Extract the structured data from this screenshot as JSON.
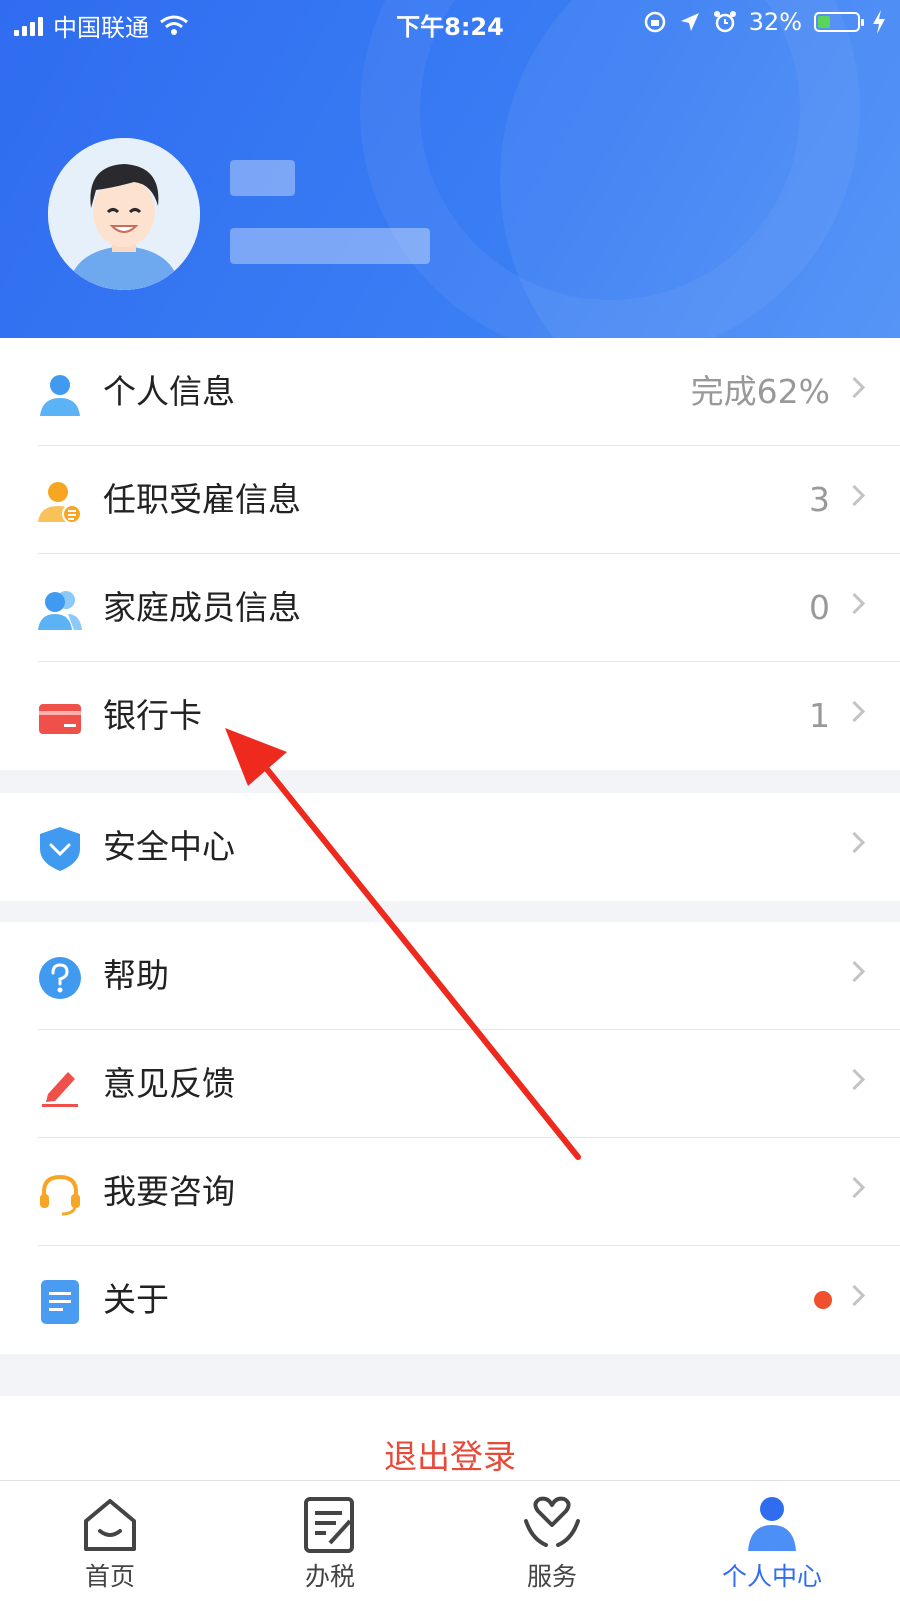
{
  "status_bar": {
    "carrier": "中国联通",
    "time": "下午8:24",
    "battery": "32%",
    "battery_level": 0.32
  },
  "colors": {
    "accent": "#2f6cf0",
    "logout": "#e84a3a",
    "badge_dot": "#f0502d"
  },
  "menu_groups": [
    [
      {
        "label": "个人信息",
        "value": "完成62%",
        "icon": "person-icon"
      },
      {
        "label": "任职受雇信息",
        "value": "3",
        "icon": "employment-icon"
      },
      {
        "label": "家庭成员信息",
        "value": "0",
        "icon": "family-icon"
      },
      {
        "label": "银行卡",
        "value": "1",
        "icon": "bank-card-icon"
      }
    ],
    [
      {
        "label": "安全中心",
        "value": "",
        "icon": "shield-icon"
      }
    ],
    [
      {
        "label": "帮助",
        "value": "",
        "icon": "help-icon"
      },
      {
        "label": "意见反馈",
        "value": "",
        "icon": "feedback-pen-icon"
      },
      {
        "label": "我要咨询",
        "value": "",
        "icon": "headset-icon"
      },
      {
        "label": "关于",
        "value": "",
        "icon": "document-icon",
        "badge": true
      }
    ]
  ],
  "logout_label": "退出登录",
  "tabs": [
    {
      "label": "首页",
      "icon": "home-icon",
      "active": false
    },
    {
      "label": "办税",
      "icon": "tax-form-icon",
      "active": false
    },
    {
      "label": "服务",
      "icon": "heart-hands-icon",
      "active": false
    },
    {
      "label": "个人中心",
      "icon": "user-center-icon",
      "active": true
    }
  ]
}
